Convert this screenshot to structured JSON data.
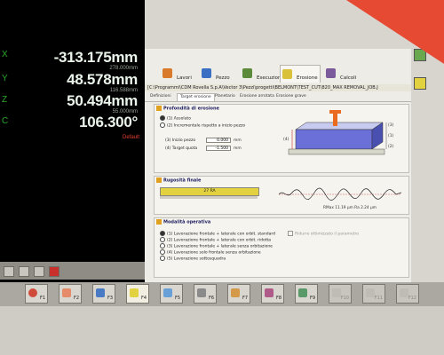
{
  "dro": {
    "values": [
      "-313.175mm",
      "48.578mm",
      "50.494mm",
      "106.300°"
    ],
    "subvalues": [
      "278.000mm",
      "116.588mm",
      "55.000mm"
    ],
    "axes": [
      "X",
      "Y",
      "Z",
      "C"
    ],
    "status": "Default"
  },
  "tabs": [
    {
      "label": "Lavori"
    },
    {
      "label": "Pezzo"
    },
    {
      "label": "Esecuzione"
    },
    {
      "label": "Erosione"
    },
    {
      "label": "Calcoli"
    }
  ],
  "path": "[C:\\Programmi\\CDM Rovella S.p.A\\Vector 3\\Pezzi\\progetti\\BELMONT\\TEST_CUT\\820_MAX REMOVAL_JOB.J",
  "subtabs": [
    "Definizioni",
    "Target erosione",
    "Planetario",
    "Erosione arrotata",
    "Erosione grave"
  ],
  "depth": {
    "title": "Profondità di erosione",
    "opt1": "(1) Assoluto",
    "opt2": "(2) Incrementale rispetto a inizio pezzo",
    "field3_label": "(3) Inizio pezzo",
    "field3_value": "0.000",
    "field4_label": "(4) Target quota",
    "field4_value": "-1.500",
    "unit": "mm",
    "diagram_labels": [
      "(4)",
      "(3)",
      "(1)",
      "(2)"
    ]
  },
  "roughness": {
    "title": "Rugosità finale",
    "bar_value": "27 RA",
    "bar_fill": 1.0,
    "readout": "RMax 11.19 µm   Ra 2.24 µm"
  },
  "operative": {
    "title": "Modalità operativa",
    "options": [
      "(1) Lavorazione frontale + laterale con orbit. standard",
      "(2) Lavorazione frontale + laterale con orbit. ridotta",
      "(3) Lavorazione frontale + laterale senza orbitazione",
      "(4) Lavorazione solo frontale senza orbitazione",
      "(5) Lavorazione sottosquadra"
    ],
    "checkbox": "Ridurre ottimizzato il parametro"
  },
  "fkeys": [
    "F1",
    "F2",
    "F3",
    "F4",
    "F5",
    "F6",
    "F7",
    "F8",
    "F9",
    "F10",
    "F11",
    "F12"
  ],
  "colors": {
    "accent": "#e74a33",
    "dro_green": "#28a828",
    "roughness_bar": "#e2d240"
  }
}
